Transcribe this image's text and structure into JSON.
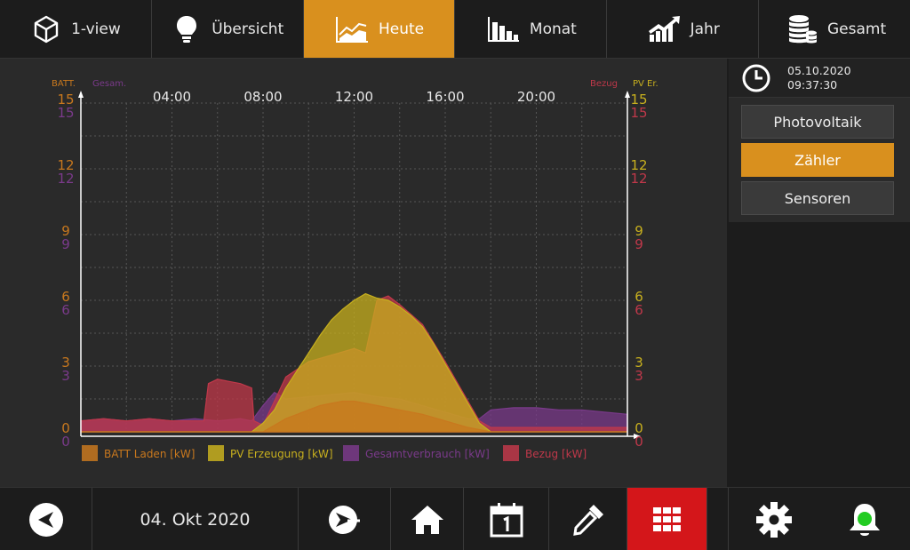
{
  "nav": {
    "tabs": [
      {
        "label": "1-view",
        "icon": "cube-icon",
        "active": false
      },
      {
        "label": "Übersicht",
        "icon": "lightbulb-icon",
        "active": false
      },
      {
        "label": "Heute",
        "icon": "area-chart-icon",
        "active": true
      },
      {
        "label": "Monat",
        "icon": "bar-chart-icon",
        "active": false
      },
      {
        "label": "Jahr",
        "icon": "trend-chart-icon",
        "active": false
      },
      {
        "label": "Gesamt",
        "icon": "coins-icon",
        "active": false
      }
    ]
  },
  "colors": {
    "accent": "#d9901e",
    "batt": "#c8781e",
    "pv": "#c8b01e",
    "gesamt": "#7a3a8a",
    "bezug": "#c0384a",
    "alert": "#d4161a"
  },
  "clock": {
    "date": "05.10.2020",
    "time": "09:37:30"
  },
  "selector": {
    "buttons": [
      {
        "label": "Photovoltaik",
        "active": false
      },
      {
        "label": "Zähler",
        "active": true
      },
      {
        "label": "Sensoren",
        "active": false
      }
    ]
  },
  "bottom": {
    "date_label": "04. Okt 2020",
    "icons": [
      "back-icon",
      "navigate-plus-icon",
      "home-icon",
      "calendar-icon",
      "pipette-icon",
      "grid-icon",
      "settings-icon",
      "bell-icon"
    ]
  },
  "chart_data": {
    "type": "area",
    "axis_labels": {
      "left_1": "BATT.",
      "left_2": "Gesam.",
      "right_1": "Bezug",
      "right_2": "PV Er."
    },
    "x_ticks": [
      "04:00",
      "08:00",
      "12:00",
      "16:00",
      "20:00"
    ],
    "xlim": [
      0,
      24
    ],
    "ylim": [
      0,
      15
    ],
    "y_ticks": [
      0,
      3,
      6,
      9,
      12,
      15
    ],
    "grid": true,
    "legend_position": "bottom",
    "series": [
      {
        "name": "BATT Laden [kW]",
        "color": "#c8781e",
        "x": [
          0,
          8,
          8.5,
          9,
          9.5,
          10,
          10.5,
          11,
          11.5,
          12,
          12.5,
          13,
          14,
          15,
          16,
          17,
          17.5,
          18,
          24
        ],
        "y": [
          0,
          0,
          0.3,
          0.6,
          0.8,
          1.0,
          1.2,
          1.3,
          1.4,
          1.4,
          1.3,
          1.2,
          1.0,
          0.8,
          0.5,
          0.2,
          0.1,
          0,
          0
        ]
      },
      {
        "name": "PV Erzeugung [kW]",
        "color": "#c8b01e",
        "x": [
          0,
          7.5,
          8,
          8.5,
          9,
          9.5,
          10,
          10.5,
          11,
          11.5,
          12,
          12.5,
          13,
          13.5,
          14,
          14.5,
          15,
          15.5,
          16,
          16.5,
          17,
          17.5,
          18,
          24
        ],
        "y": [
          0,
          0,
          0.4,
          1.0,
          2.0,
          2.8,
          3.6,
          4.4,
          5.1,
          5.6,
          6.0,
          6.3,
          6.1,
          6.0,
          5.7,
          5.3,
          4.8,
          4.0,
          3.1,
          2.2,
          1.3,
          0.4,
          0,
          0
        ]
      },
      {
        "name": "Gesamtverbrauch [kW]",
        "color": "#7a3a8a",
        "x": [
          0,
          1,
          2,
          3,
          4,
          5,
          6,
          7,
          7.5,
          8,
          8.5,
          9,
          10,
          11,
          12,
          13,
          14,
          15,
          16,
          17,
          17.5,
          18,
          19,
          20,
          21,
          22,
          23,
          24
        ],
        "y": [
          0.5,
          0.6,
          0.5,
          0.6,
          0.5,
          0.6,
          0.5,
          0.6,
          0.5,
          1.2,
          1.8,
          1.5,
          1.6,
          1.7,
          1.8,
          1.6,
          1.5,
          1.2,
          0.9,
          0.6,
          0.6,
          1.0,
          1.1,
          1.1,
          1.0,
          1.0,
          0.9,
          0.8
        ]
      },
      {
        "name": "Bezug [kW]",
        "color": "#c0384a",
        "x": [
          0,
          1,
          2,
          3,
          4,
          5,
          5.4,
          5.6,
          6,
          7,
          7.5,
          7.6,
          8,
          9,
          10,
          11,
          12,
          12.5,
          13,
          13.5,
          14,
          15,
          16,
          17,
          17.5,
          18,
          24
        ],
        "y": [
          0.5,
          0.6,
          0.5,
          0.6,
          0.5,
          0.5,
          0.5,
          2.2,
          2.4,
          2.2,
          2.0,
          0.5,
          0.3,
          2.5,
          3.2,
          3.5,
          3.8,
          3.6,
          6.0,
          6.2,
          5.8,
          4.9,
          3.2,
          1.4,
          0.5,
          0.2,
          0.2
        ]
      }
    ]
  }
}
